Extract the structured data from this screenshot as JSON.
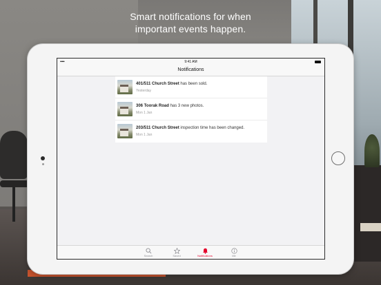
{
  "headline": {
    "line1": "Smart notifications for when",
    "line2": "important events happen."
  },
  "status_bar": {
    "signal": "•••••",
    "time": "9:41 AM"
  },
  "nav": {
    "title": "Notifications"
  },
  "notifications": [
    {
      "address": "401/511 Church Street",
      "text": " has been sold.",
      "when": "Yesterday"
    },
    {
      "address": "306 Toorak Road",
      "text": " has 3 new photos.",
      "when": "Mon 1 Jan"
    },
    {
      "address": "203/511 Church Street",
      "text": " inspection time has been changed.",
      "when": "Mon 1 Jan"
    }
  ],
  "tabs": [
    {
      "label": "Search",
      "icon": "search-icon",
      "active": false
    },
    {
      "label": "Saved",
      "icon": "star-icon",
      "active": false
    },
    {
      "label": "Notifications",
      "icon": "bell-icon",
      "active": true
    },
    {
      "label": "Me",
      "icon": "info-icon",
      "active": false
    }
  ],
  "colors": {
    "accent": "#e4002b",
    "inactive": "#8e8e93"
  }
}
